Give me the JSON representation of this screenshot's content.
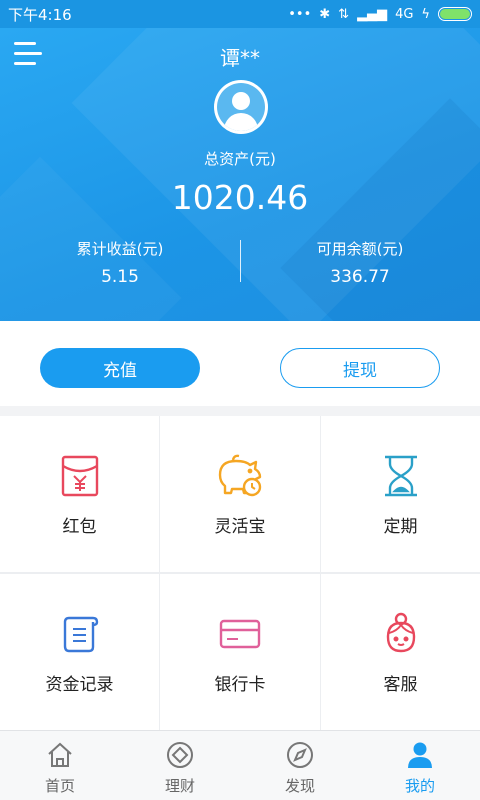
{
  "status_bar": {
    "time": "下午4:16",
    "network": "4G"
  },
  "header": {
    "username": "谭**",
    "total_assets_label": "总资产(元)",
    "total_assets_value": "1020.46",
    "cumulative_income_label": "累计收益(元)",
    "cumulative_income_value": "5.15",
    "available_balance_label": "可用余额(元)",
    "available_balance_value": "336.77"
  },
  "actions": {
    "recharge_label": "充值",
    "withdraw_label": "提现"
  },
  "grid": [
    {
      "label": "红包",
      "icon": "red-envelope-icon"
    },
    {
      "label": "灵活宝",
      "icon": "piggy-bank-icon"
    },
    {
      "label": "定期",
      "icon": "hourglass-icon"
    },
    {
      "label": "资金记录",
      "icon": "scroll-record-icon"
    },
    {
      "label": "银行卡",
      "icon": "bank-card-icon"
    },
    {
      "label": "客服",
      "icon": "customer-service-icon"
    }
  ],
  "bottom_nav": [
    {
      "label": "首页",
      "icon": "home-icon",
      "active": false
    },
    {
      "label": "理财",
      "icon": "finance-icon",
      "active": false
    },
    {
      "label": "发现",
      "icon": "compass-icon",
      "active": false
    },
    {
      "label": "我的",
      "icon": "user-icon",
      "active": true
    }
  ],
  "colors": {
    "primary": "#1a9cf0",
    "header_bg": "#1c95e6",
    "red_icon": "#e8485d",
    "orange_icon": "#f5a623",
    "teal_icon": "#2aa0c8",
    "blue_icon": "#3a78d8",
    "pink_icon": "#e0609a"
  }
}
